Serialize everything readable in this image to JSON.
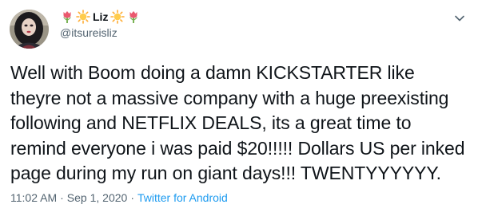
{
  "user": {
    "display_name": "Liz",
    "handle": "@itsureisliz",
    "name_emojis": [
      "tulip-icon",
      "sun-icon",
      "sun-icon",
      "tulip-icon"
    ],
    "avatar": "avatar"
  },
  "tweet": {
    "text": "Well with Boom doing a damn KICKSTARTER like theyre not a massive company with a huge preexisting following and NETFLIX DEALS, its a great time to remind everyone i was paid $20!!!!! Dollars US per inked page during my run on giant days!!! TWENTYYYYYY.",
    "time": "11:02 AM",
    "separator": "·",
    "date": "Sep 1, 2020",
    "source": "Twitter for Android"
  },
  "menu": {
    "icon": "chevron-down-icon"
  },
  "colors": {
    "text": "#0f1419",
    "secondary": "#536471",
    "link": "#1d9bf0"
  }
}
